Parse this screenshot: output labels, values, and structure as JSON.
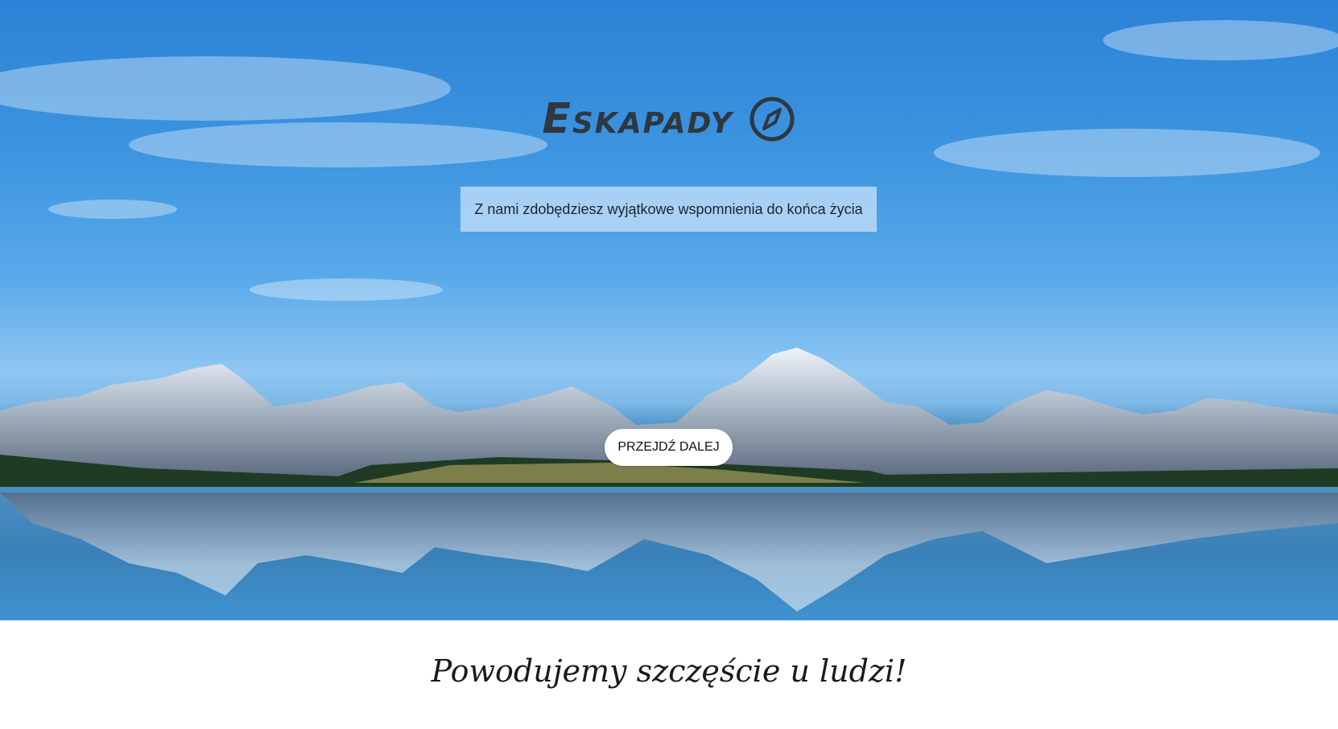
{
  "hero": {
    "brand_title": "Eskapady",
    "brand_icon": "compass-icon",
    "tagline": "Z nami zdobędziesz wyjątkowe wspomnienia do końca życia",
    "cta_label": "PRZEJDŹ DALEJ"
  },
  "section": {
    "slogan": "Powodujemy szczęście u ludzi!"
  },
  "colors": {
    "sky": "#3d95e0",
    "brand_text": "#2f3740",
    "tagline_bg": "#c8e2fa",
    "button_bg": "#ffffff"
  }
}
